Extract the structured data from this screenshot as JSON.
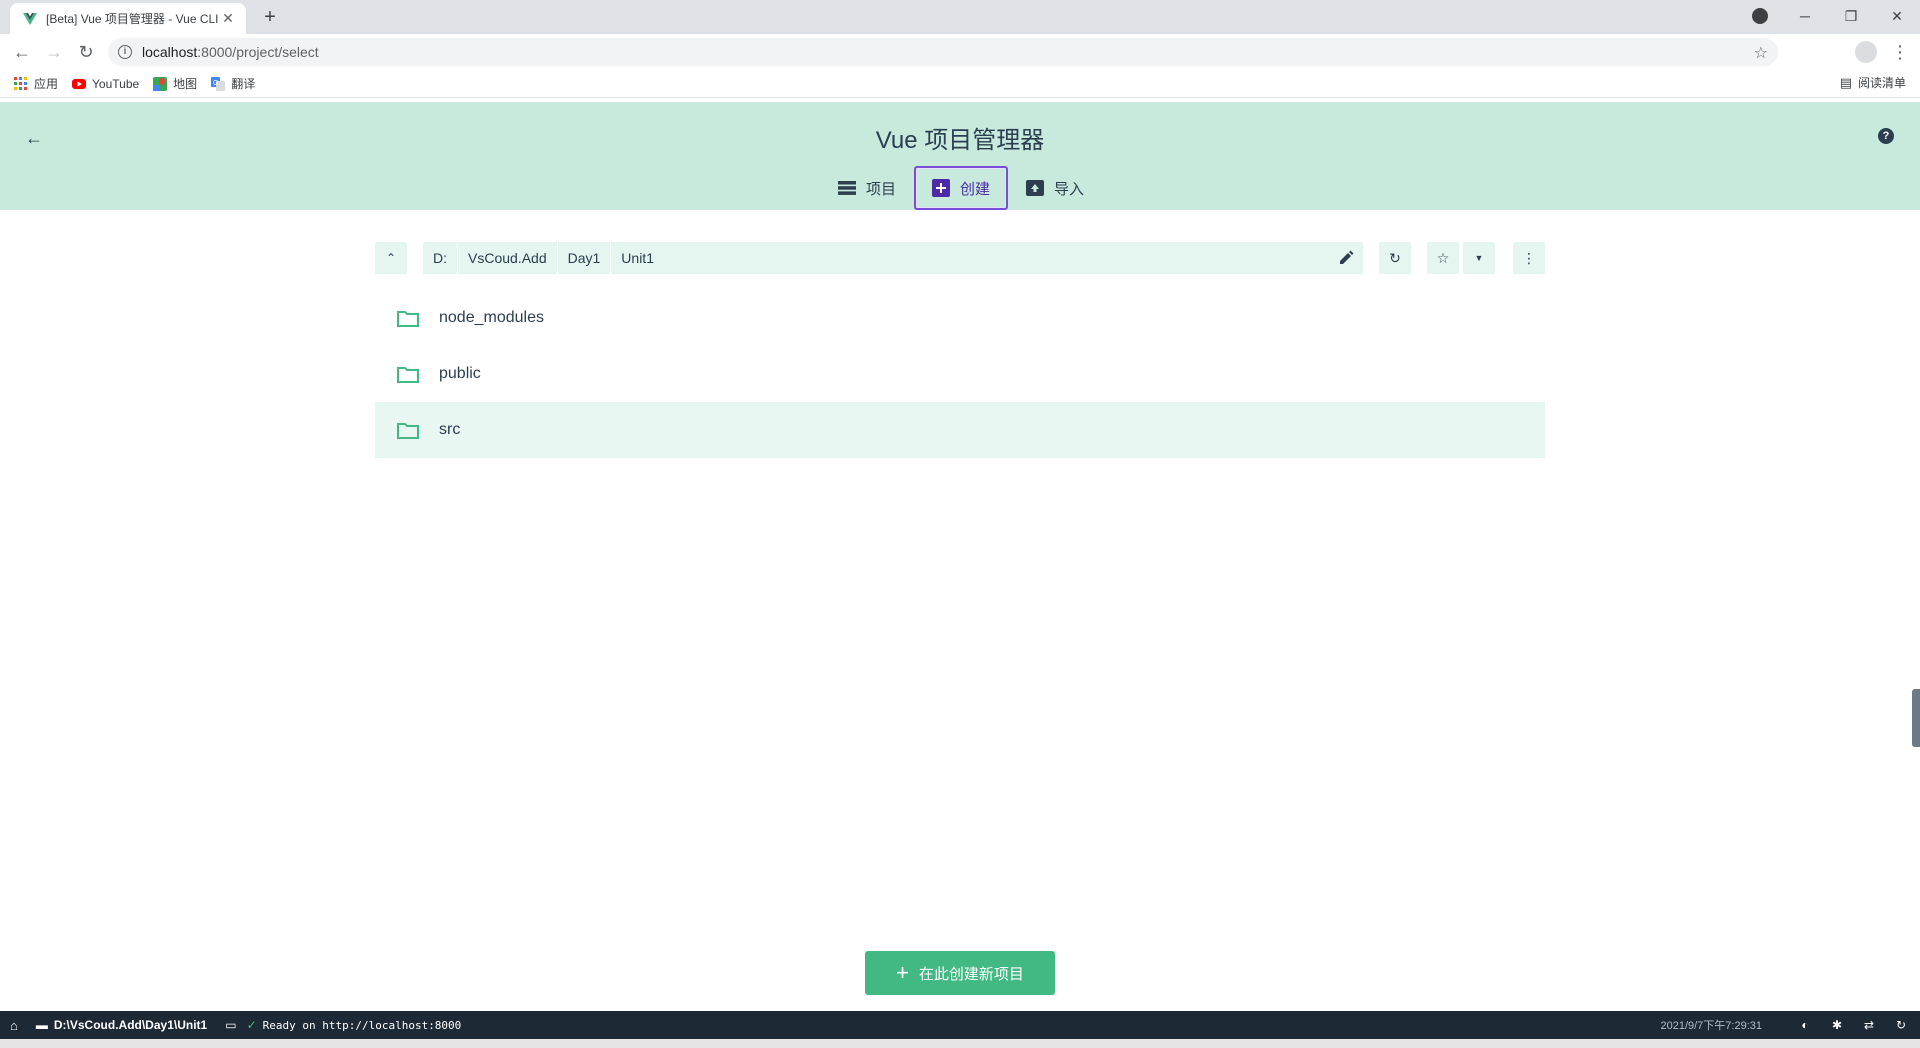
{
  "browser": {
    "tab_title": "[Beta] Vue 项目管理器 - Vue CLI",
    "url_host": "localhost",
    "url_path": ":8000/project/select"
  },
  "bookmarks": {
    "items": [
      "应用",
      "YouTube",
      "地图",
      "翻译"
    ],
    "reading_list": "阅读清单"
  },
  "header": {
    "title": "Vue 项目管理器",
    "tabs": [
      {
        "label": "项目",
        "icon": "list-icon"
      },
      {
        "label": "创建",
        "icon": "add-box-icon",
        "active": true
      },
      {
        "label": "导入",
        "icon": "unarchive-icon"
      }
    ]
  },
  "path": {
    "crumbs": [
      "D:",
      "VsCoud.Add",
      "Day1",
      "Unit1"
    ]
  },
  "folders": [
    {
      "name": "node_modules"
    },
    {
      "name": "public"
    },
    {
      "name": "src",
      "selected": true
    }
  ],
  "actions": {
    "create_here": "在此创建新项目"
  },
  "statusbar": {
    "cwd": "D:\\VsCoud.Add\\Day1\\Unit1",
    "log": "Ready on http://localhost:8000",
    "time": "2021/9/7下午7:29:31"
  },
  "colors": {
    "header_bg": "#c7eadd",
    "accent": "#42b983",
    "active_tab_border": "#7b4dd6",
    "statusbar_bg": "#1d2935"
  }
}
